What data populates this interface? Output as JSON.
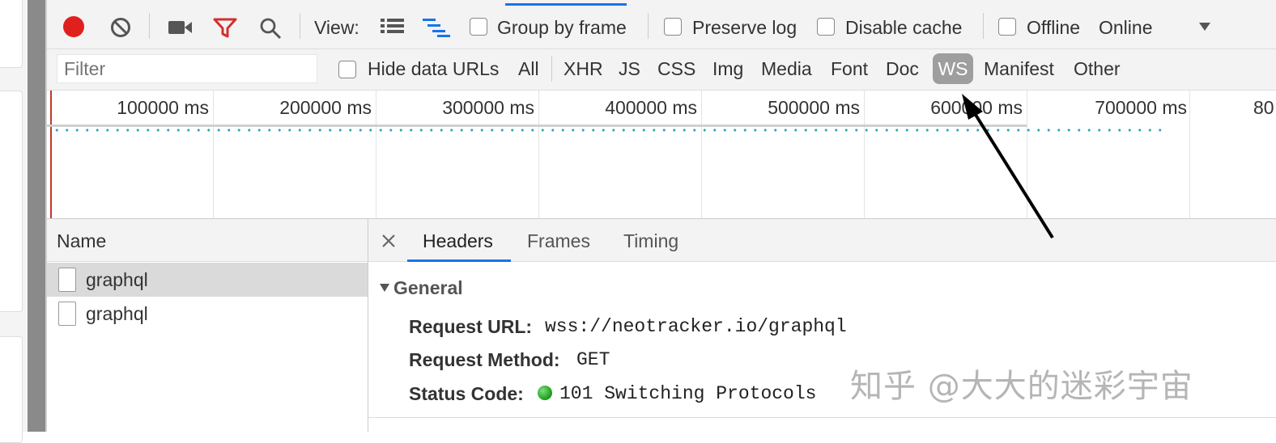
{
  "toolbar": {
    "view_label": "View:",
    "group_by_frame": "Group by frame",
    "preserve_log": "Preserve log",
    "disable_cache": "Disable cache",
    "offline": "Offline",
    "throttle_value": "Online",
    "record_color": "#e0201c",
    "filter_icon_color": "#d32f2f"
  },
  "filterbar": {
    "filter_placeholder": "Filter",
    "hide_data_urls": "Hide data URLs",
    "types": [
      "All",
      "XHR",
      "JS",
      "CSS",
      "Img",
      "Media",
      "Font",
      "Doc",
      "WS",
      "Manifest",
      "Other"
    ],
    "selected_type": "WS"
  },
  "overview": {
    "ticks": [
      "100000 ms",
      "200000 ms",
      "300000 ms",
      "400000 ms",
      "500000 ms",
      "600000 ms",
      "700000 ms",
      "80"
    ]
  },
  "names": {
    "header": "Name",
    "rows": [
      "graphql",
      "graphql"
    ],
    "selected_index": 0
  },
  "detail": {
    "tabs": [
      "Headers",
      "Frames",
      "Timing"
    ],
    "active_tab": "Headers",
    "section_title": "General",
    "request_url_label": "Request URL:",
    "request_url_value": "wss://neotracker.io/graphql",
    "request_method_label": "Request Method:",
    "request_method_value": "GET",
    "status_code_label": "Status Code:",
    "status_code_value": "101 Switching Protocols",
    "status_color": "#22aa22"
  },
  "watermark": "知乎 @大大的迷彩宇宙"
}
